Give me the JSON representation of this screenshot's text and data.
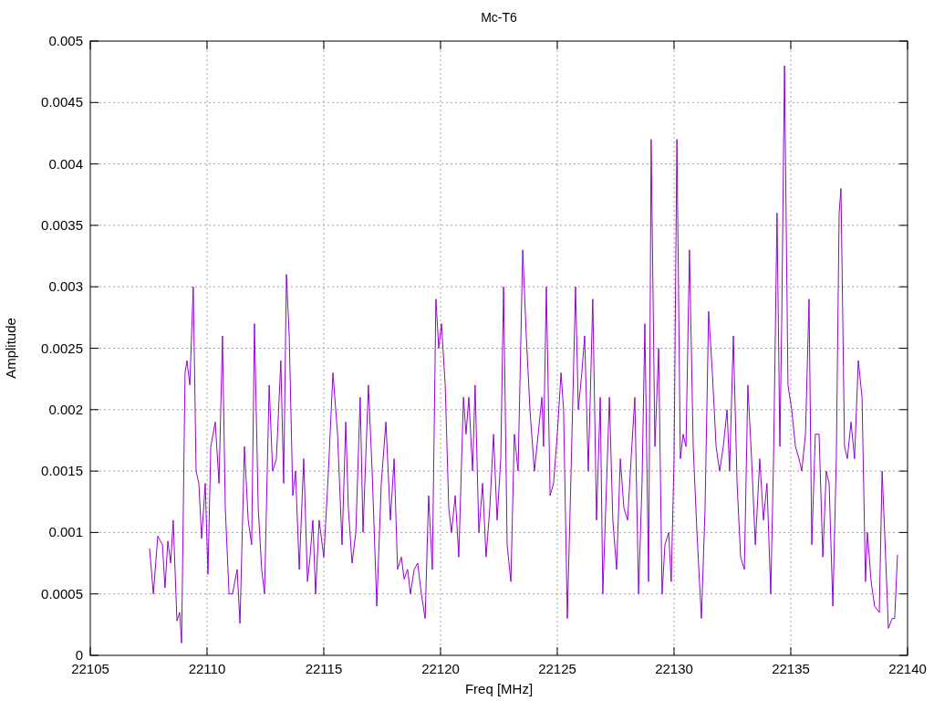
{
  "chart_data": {
    "type": "line",
    "title": "Mc-T6",
    "xlabel": "Freq [MHz]",
    "ylabel": "Amplitude",
    "xlim": [
      22105,
      22140
    ],
    "ylim": [
      0,
      0.005
    ],
    "xticks": [
      22105,
      22110,
      22115,
      22120,
      22125,
      22130,
      22135,
      22140
    ],
    "yticks": [
      0,
      0.0005,
      0.001,
      0.0015,
      0.002,
      0.0025,
      0.003,
      0.0035,
      0.004,
      0.0045,
      0.005
    ],
    "x": [
      22107.54,
      22107.7,
      22107.89,
      22108.09,
      22108.2,
      22108.32,
      22108.44,
      22108.55,
      22108.71,
      22108.83,
      22108.91,
      22109.06,
      22109.14,
      22109.26,
      22109.41,
      22109.53,
      22109.65,
      22109.77,
      22109.92,
      22110.04,
      22110.16,
      22110.35,
      22110.51,
      22110.66,
      22110.78,
      22110.94,
      22111.09,
      22111.29,
      22111.41,
      22111.6,
      22111.76,
      22111.91,
      22112.03,
      22112.19,
      22112.34,
      22112.46,
      22112.66,
      22112.81,
      22112.97,
      22113.16,
      22113.28,
      22113.4,
      22113.52,
      22113.67,
      22113.79,
      22113.95,
      22114.14,
      22114.3,
      22114.41,
      22114.53,
      22114.65,
      22114.8,
      22115.0,
      22115.2,
      22115.39,
      22115.59,
      22115.78,
      22115.94,
      22116.05,
      22116.21,
      22116.37,
      22116.56,
      22116.68,
      22116.91,
      22117.07,
      22117.27,
      22117.46,
      22117.66,
      22117.85,
      22118.01,
      22118.16,
      22118.32,
      22118.44,
      22118.59,
      22118.71,
      22118.87,
      22119.02,
      22119.18,
      22119.34,
      22119.49,
      22119.65,
      22119.8,
      22119.92,
      22120.04,
      22120.2,
      22120.35,
      22120.47,
      22120.63,
      22120.78,
      22120.98,
      22121.09,
      22121.21,
      22121.37,
      22121.48,
      22121.64,
      22121.8,
      22121.95,
      22122.11,
      22122.27,
      22122.42,
      22122.58,
      22122.7,
      22122.85,
      22123.01,
      22123.16,
      22123.32,
      22123.52,
      22123.67,
      22123.83,
      22124.02,
      22124.18,
      22124.34,
      22124.41,
      22124.53,
      22124.69,
      22124.84,
      22125.0,
      22125.16,
      22125.27,
      22125.43,
      22125.59,
      22125.78,
      22125.9,
      22126.05,
      22126.17,
      22126.33,
      22126.52,
      22126.68,
      22126.84,
      22126.95,
      22127.11,
      22127.23,
      22127.38,
      22127.54,
      22127.7,
      22127.85,
      22128.01,
      22128.16,
      22128.32,
      22128.48,
      22128.63,
      22128.75,
      22128.91,
      22129.02,
      22129.18,
      22129.34,
      22129.49,
      22129.61,
      22129.77,
      22129.88,
      22130.0,
      22130.12,
      22130.27,
      22130.39,
      22130.51,
      22130.66,
      22130.82,
      22130.98,
      22131.17,
      22131.33,
      22131.48,
      22131.64,
      22131.8,
      22131.95,
      22132.11,
      22132.27,
      22132.38,
      22132.54,
      22132.7,
      22132.85,
      22133.01,
      22133.16,
      22133.32,
      22133.48,
      22133.67,
      22133.83,
      22133.98,
      22134.14,
      22134.26,
      22134.41,
      22134.53,
      22134.61,
      22134.73,
      22134.88,
      22135.04,
      22135.2,
      22135.35,
      22135.47,
      22135.63,
      22135.78,
      22135.9,
      22136.05,
      22136.21,
      22136.37,
      22136.52,
      22136.64,
      22136.8,
      22136.95,
      22137.07,
      22137.15,
      22137.3,
      22137.42,
      22137.58,
      22137.73,
      22137.89,
      22138.05,
      22138.2,
      22138.28,
      22138.44,
      22138.59,
      22138.79,
      22138.91,
      22139.02,
      22139.18,
      22139.34,
      22139.45,
      22139.57
    ],
    "grid": true,
    "series": [
      {
        "color": "#9400d3",
        "values": [
          0.00087,
          0.0005,
          0.00097,
          0.0009,
          0.00055,
          0.00093,
          0.00075,
          0.0011,
          0.00028,
          0.00035,
          0.0001,
          0.0023,
          0.0024,
          0.0022,
          0.003,
          0.0015,
          0.0014,
          0.00095,
          0.0014,
          0.00066,
          0.0017,
          0.0019,
          0.0014,
          0.0026,
          0.0012,
          0.0005,
          0.0005,
          0.0007,
          0.00026,
          0.0017,
          0.0011,
          0.0009,
          0.0027,
          0.0012,
          0.0007,
          0.0005,
          0.0022,
          0.0015,
          0.0016,
          0.0024,
          0.0014,
          0.0031,
          0.0026,
          0.0013,
          0.0015,
          0.0007,
          0.0016,
          0.0006,
          0.0008,
          0.0011,
          0.0005,
          0.0011,
          0.0008,
          0.0015,
          0.0023,
          0.0018,
          0.0009,
          0.0019,
          0.0012,
          0.00075,
          0.001,
          0.0021,
          0.001,
          0.0022,
          0.0015,
          0.0004,
          0.0014,
          0.0019,
          0.0011,
          0.0016,
          0.0007,
          0.0008,
          0.00062,
          0.0007,
          0.0005,
          0.0007,
          0.00075,
          0.0005,
          0.0003,
          0.0013,
          0.0007,
          0.0029,
          0.0025,
          0.0027,
          0.0022,
          0.0012,
          0.001,
          0.0013,
          0.0008,
          0.0021,
          0.0018,
          0.0021,
          0.0015,
          0.0022,
          0.001,
          0.0014,
          0.0008,
          0.0012,
          0.0018,
          0.0011,
          0.0016,
          0.003,
          0.0009,
          0.0006,
          0.0018,
          0.0015,
          0.0033,
          0.0026,
          0.002,
          0.0015,
          0.0018,
          0.0021,
          0.0017,
          0.003,
          0.0013,
          0.0014,
          0.0018,
          0.0023,
          0.002,
          0.0003,
          0.0015,
          0.003,
          0.002,
          0.0023,
          0.0026,
          0.0015,
          0.0029,
          0.0011,
          0.0021,
          0.0005,
          0.0014,
          0.0021,
          0.0011,
          0.0007,
          0.0016,
          0.0012,
          0.0011,
          0.0016,
          0.0021,
          0.0005,
          0.0014,
          0.0027,
          0.0006,
          0.0042,
          0.0017,
          0.0025,
          0.0005,
          0.0009,
          0.001,
          0.0006,
          0.0016,
          0.0042,
          0.0016,
          0.0018,
          0.0017,
          0.0033,
          0.0017,
          0.001,
          0.0003,
          0.0012,
          0.0028,
          0.0023,
          0.0017,
          0.0015,
          0.0017,
          0.002,
          0.0015,
          0.0026,
          0.0014,
          0.0008,
          0.0007,
          0.0022,
          0.0016,
          0.0009,
          0.0016,
          0.0011,
          0.0014,
          0.0005,
          0.0016,
          0.0036,
          0.0017,
          0.0027,
          0.0048,
          0.0022,
          0.002,
          0.0017,
          0.0016,
          0.0015,
          0.0018,
          0.0029,
          0.0009,
          0.0018,
          0.0018,
          0.0008,
          0.0015,
          0.0014,
          0.0004,
          0.0016,
          0.0036,
          0.0038,
          0.0017,
          0.0016,
          0.0019,
          0.0016,
          0.0024,
          0.0021,
          0.0006,
          0.001,
          0.0006,
          0.0004,
          0.00035,
          0.0015,
          0.001,
          0.00022,
          0.0003,
          0.0003,
          0.00082
        ]
      }
    ]
  }
}
